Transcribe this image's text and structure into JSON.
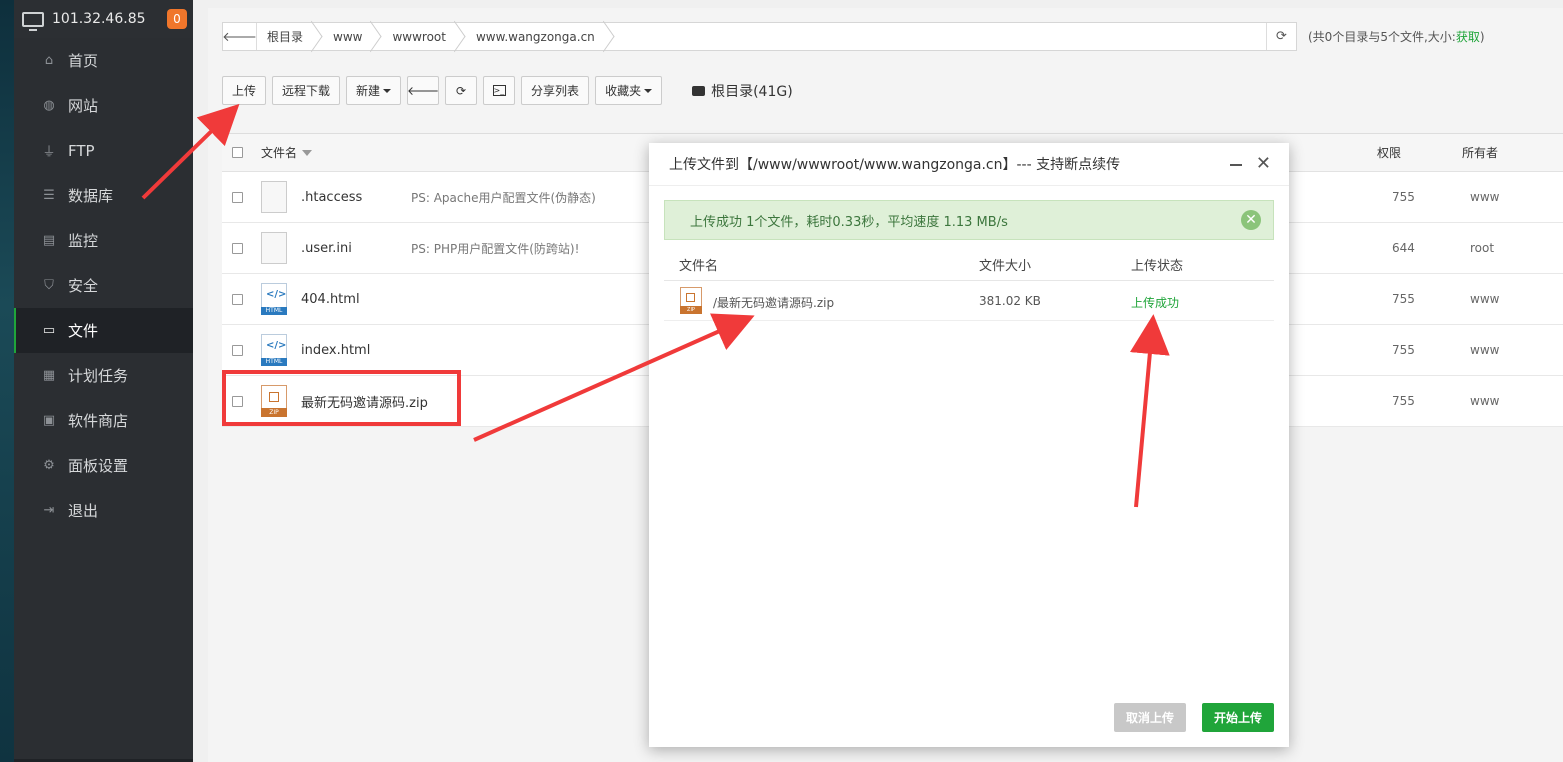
{
  "sidebar": {
    "server_ip": "101.32.46.85",
    "badge": "0",
    "items": [
      {
        "label": "首页",
        "icon": "home-icon",
        "glyph": "⌂"
      },
      {
        "label": "网站",
        "icon": "globe-icon",
        "glyph": "◍"
      },
      {
        "label": "FTP",
        "icon": "ftp-icon",
        "glyph": "⏚"
      },
      {
        "label": "数据库",
        "icon": "database-icon",
        "glyph": "☰"
      },
      {
        "label": "监控",
        "icon": "monitor-icon",
        "glyph": "▤"
      },
      {
        "label": "安全",
        "icon": "shield-icon",
        "glyph": "⛉"
      },
      {
        "label": "文件",
        "icon": "folder-icon",
        "glyph": "▭"
      },
      {
        "label": "计划任务",
        "icon": "calendar-icon",
        "glyph": "▦"
      },
      {
        "label": "软件商店",
        "icon": "apps-icon",
        "glyph": "▣"
      },
      {
        "label": "面板设置",
        "icon": "gear-icon",
        "glyph": "⚙"
      },
      {
        "label": "退出",
        "icon": "logout-icon",
        "glyph": "⇥"
      }
    ],
    "active_index": 6
  },
  "path": {
    "crumbs": [
      "根目录",
      "www",
      "wwwroot",
      "www.wangzonga.cn"
    ],
    "summary_prefix": "(共0个目录与5个文件,大小:",
    "summary_link": "获取",
    "summary_suffix": ")"
  },
  "toolbar": {
    "upload": "上传",
    "remote_download": "远程下载",
    "new": "新建",
    "share_list": "分享列表",
    "favorites": "收藏夹",
    "disk": "根目录(41G)"
  },
  "table": {
    "headers": {
      "name": "文件名",
      "perm": "权限",
      "owner": "所有者"
    },
    "rows": [
      {
        "name": ".htaccess",
        "note": "PS: Apache用户配置文件(伪静态)",
        "perm": "755",
        "owner": "www",
        "type": "file"
      },
      {
        "name": ".user.ini",
        "note": "PS: PHP用户配置文件(防跨站)!",
        "perm": "644",
        "owner": "root",
        "type": "file"
      },
      {
        "name": "404.html",
        "note": "",
        "perm": "755",
        "owner": "www",
        "type": "html"
      },
      {
        "name": "index.html",
        "note": "",
        "perm": "755",
        "owner": "www",
        "type": "html"
      },
      {
        "name": "最新无码邀请源码.zip",
        "note": "",
        "perm": "755",
        "owner": "www",
        "type": "zip"
      }
    ],
    "html_label": "HTML",
    "zip_label": "ZIP"
  },
  "dialog": {
    "title": "上传文件到【/www/wwwroot/www.wangzonga.cn】--- 支持断点续传",
    "alert": "上传成功 1个文件，耗时0.33秒，平均速度 1.13 MB/s",
    "headers": {
      "name": "文件名",
      "size": "文件大小",
      "status": "上传状态"
    },
    "file": {
      "name": "/最新无码邀请源码.zip",
      "size": "381.02 KB",
      "status": "上传成功"
    },
    "cancel": "取消上传",
    "start": "开始上传"
  }
}
